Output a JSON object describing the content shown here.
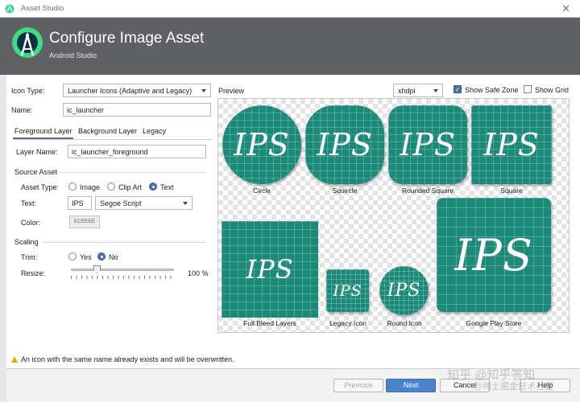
{
  "window": {
    "title": "Asset Studio",
    "close_glyph": "✕"
  },
  "header": {
    "title": "Configure Image Asset",
    "subtitle": "Android Studio"
  },
  "form": {
    "icon_type_label": "Icon Type:",
    "icon_type_value": "Launcher Icons (Adaptive and Legacy)",
    "name_label": "Name:",
    "name_value": "ic_launcher",
    "tabs": [
      "Foreground Layer",
      "Background Layer",
      "Legacy"
    ],
    "layer_name_label": "Layer Name:",
    "layer_name_value": "ic_launcher_foreground",
    "source_asset_label": "Source Asset",
    "asset_type_label": "Asset Type:",
    "asset_type_options": [
      "Image",
      "Clip Art",
      "Text"
    ],
    "asset_type_selected": "Text",
    "text_label": "Text:",
    "text_value": "IPS",
    "font_value": "Segoe Script",
    "color_label": "Color:",
    "color_value": "ECEEEE",
    "scaling_label": "Scaling",
    "trim_label": "Trim:",
    "trim_options": [
      "Yes",
      "No"
    ],
    "trim_selected": "No",
    "resize_label": "Resize:",
    "resize_value": "100 %",
    "resize_slider_fraction": 0.25
  },
  "preview": {
    "label": "Preview",
    "density": "xhdpi",
    "show_safe_zone_label": "Show Safe Zone",
    "show_safe_zone": true,
    "show_grid_label": "Show Grid",
    "show_grid": false,
    "icon_text": "IPS",
    "icon_color": "#1c8a78",
    "captions": [
      "Circle",
      "Squircle",
      "Rounded Square",
      "Square",
      "Full Bleed Layers",
      "Legacy Icon",
      "Round Icon",
      "Google Play Store"
    ]
  },
  "footer": {
    "warning": "An icon with the same name already exists and will be overwritten.",
    "buttons": {
      "previous": "Previous",
      "next": "Next",
      "cancel": "Cancel",
      "help": "Help"
    },
    "watermark": "知乎 @知乎答知",
    "watermark2": "@稀土掘金技术社区"
  }
}
